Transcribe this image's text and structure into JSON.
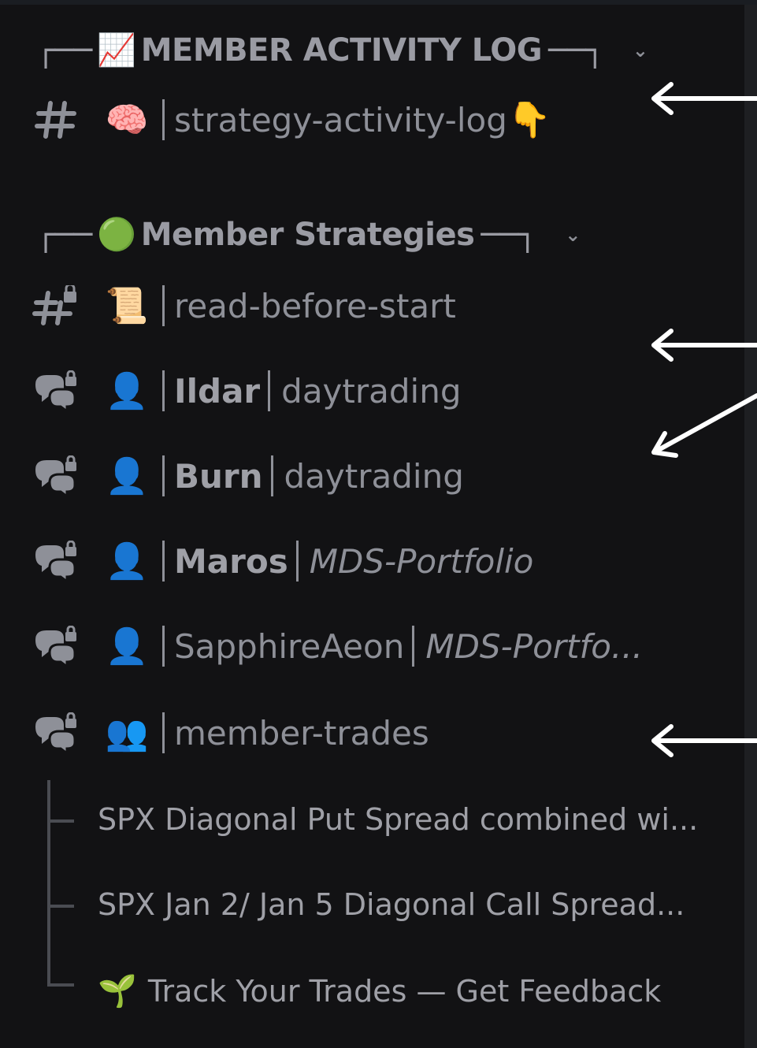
{
  "categories": [
    {
      "label": "MEMBER ACTIVITY LOG",
      "prefix": "┌──",
      "suffix": "──┐",
      "emoji": "📈",
      "chevron": "⌄",
      "style": "caps"
    },
    {
      "label": "Member Strategies",
      "prefix": "┌──",
      "suffix": "──┐",
      "emoji": "🟢",
      "chevron": "⌄",
      "style": "bold"
    }
  ],
  "channels": {
    "activity": {
      "icon": "hash-icon",
      "emoji": "🧠",
      "name": "strategy-activity-log",
      "trail_emoji": "👇"
    },
    "read": {
      "icon": "hash-lock-icon",
      "emoji": "📜",
      "name": "read-before-start"
    },
    "forums": [
      {
        "emoji": "👤",
        "member": "Ildar",
        "tag": "daytrading",
        "tag_style": "normal"
      },
      {
        "emoji": "👤",
        "member": "Burn",
        "tag": "daytrading",
        "tag_style": "normal"
      },
      {
        "emoji": "👤",
        "member": "Maros",
        "tag": "MDS-Portfolio",
        "tag_style": "italic"
      },
      {
        "emoji": "👤",
        "member": "SapphireAeon",
        "tag": "MDS-Portfo...",
        "tag_style": "italic"
      }
    ],
    "member_trades": {
      "emoji": "👥",
      "name": "member-trades"
    }
  },
  "threads": [
    {
      "label": "SPX Diagonal Put Spread combined wi..."
    },
    {
      "label": "SPX Jan 2/ Jan 5 Diagonal Call Spread..."
    },
    {
      "emoji": "🌱",
      "label": "Track Your Trades — Get Feedback"
    }
  ],
  "colors": {
    "background": "#121214",
    "text": "#9fa0a7",
    "arrow": "#ffffff"
  }
}
